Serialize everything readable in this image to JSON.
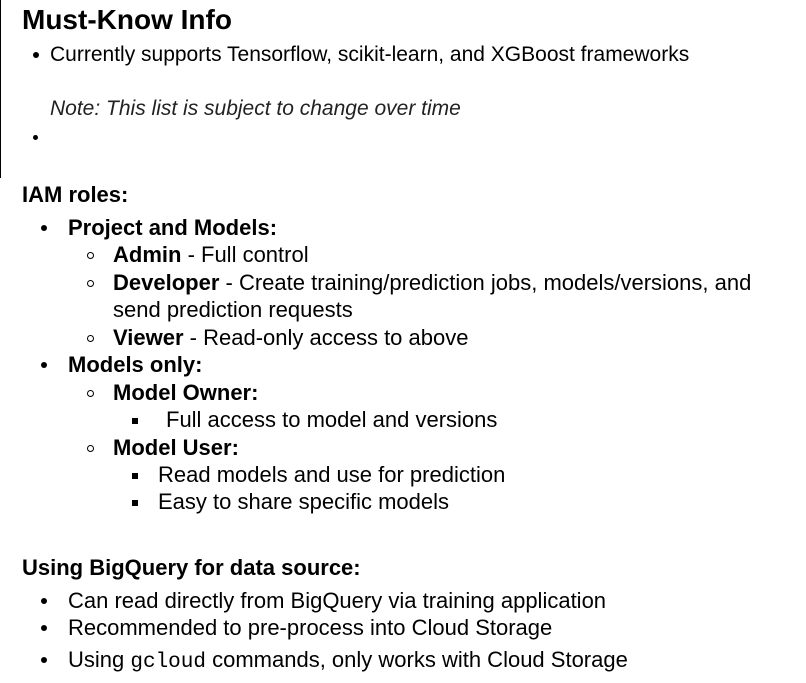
{
  "title": "Must-Know Info",
  "intro": {
    "bullet_text": "Currently supports Tensorflow, scikit-learn, and XGBoost frameworks",
    "note": "Note: This list is subject to change over time"
  },
  "iam": {
    "heading": "IAM roles:",
    "project_models": {
      "label": "Project and Models:",
      "roles": [
        {
          "name": "Admin",
          "desc": " - Full control"
        },
        {
          "name": "Developer",
          "desc": " - Create training/prediction jobs, models/versions, and",
          "desc_cont": "send prediction requests"
        },
        {
          "name": "Viewer",
          "desc": " - Read-only access to above"
        }
      ]
    },
    "models_only": {
      "label": "Models only:",
      "owner": {
        "name": "Model Owner:",
        "items": [
          "Full access to model and versions"
        ]
      },
      "user": {
        "name": "Model User:",
        "items": [
          "Read models and use for prediction",
          "Easy to share specific models"
        ]
      }
    }
  },
  "bigquery": {
    "heading": "Using BigQuery for data source:",
    "items": [
      "Can read directly from BigQuery via training application",
      "Recommended to pre-process into Cloud Storage"
    ],
    "gcloud_prefix": "Using ",
    "gcloud_code": "gcloud",
    "gcloud_suffix": " commands, only works with Cloud Storage"
  }
}
